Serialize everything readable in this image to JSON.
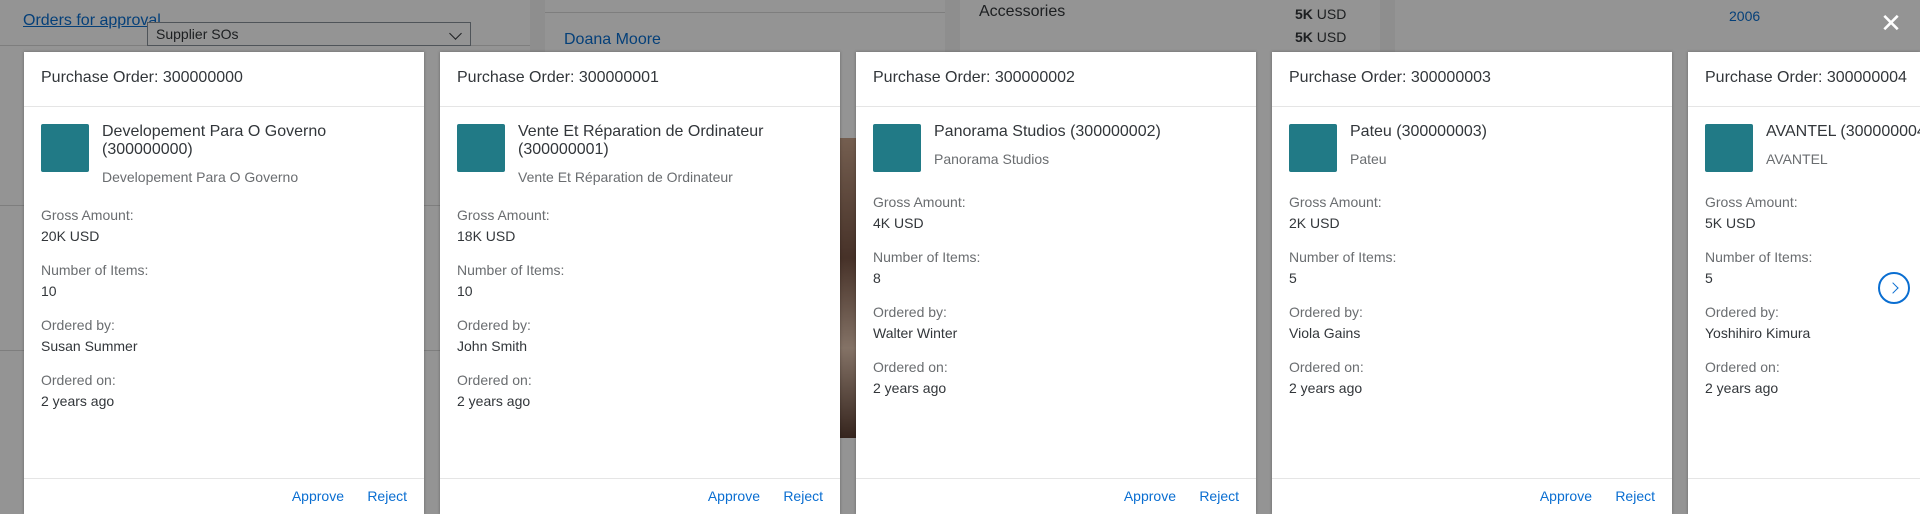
{
  "background": {
    "link": "Orders for approval",
    "select_value": "Supplier SOs",
    "person_name": "Doana Moore",
    "category": "Accessories",
    "amount_1": "5K",
    "amount_1_unit": "USD",
    "amount_2": "5K",
    "amount_2_unit": "USD",
    "year": "2006"
  },
  "close_icon": "close-icon",
  "cards": [
    {
      "header": "Purchase Order: 300000000",
      "title": "Developement Para O Governo (300000000)",
      "subtitle": "Developement Para O Governo",
      "gross_label": "Gross Amount:",
      "gross_value": "20K USD",
      "items_label": "Number of Items:",
      "items_value": "10",
      "ordered_by_label": "Ordered by:",
      "ordered_by_value": "Susan Summer",
      "ordered_on_label": "Ordered on:",
      "ordered_on_value": "2 years ago",
      "approve": "Approve",
      "reject": "Reject"
    },
    {
      "header": "Purchase Order: 300000001",
      "title": "Vente Et Réparation de Ordinateur (300000001)",
      "subtitle": "Vente Et Réparation de Ordinateur",
      "gross_label": "Gross Amount:",
      "gross_value": "18K USD",
      "items_label": "Number of Items:",
      "items_value": "10",
      "ordered_by_label": "Ordered by:",
      "ordered_by_value": "John Smith",
      "ordered_on_label": "Ordered on:",
      "ordered_on_value": "2 years ago",
      "approve": "Approve",
      "reject": "Reject"
    },
    {
      "header": "Purchase Order: 300000002",
      "title": "Panorama Studios (300000002)",
      "subtitle": "Panorama Studios",
      "gross_label": "Gross Amount:",
      "gross_value": "4K USD",
      "items_label": "Number of Items:",
      "items_value": "8",
      "ordered_by_label": "Ordered by:",
      "ordered_by_value": "Walter Winter",
      "ordered_on_label": "Ordered on:",
      "ordered_on_value": "2 years ago",
      "approve": "Approve",
      "reject": "Reject"
    },
    {
      "header": "Purchase Order: 300000003",
      "title": "Pateu (300000003)",
      "subtitle": "Pateu",
      "gross_label": "Gross Amount:",
      "gross_value": "2K USD",
      "items_label": "Number of Items:",
      "items_value": "5",
      "ordered_by_label": "Ordered by:",
      "ordered_by_value": "Viola Gains",
      "ordered_on_label": "Ordered on:",
      "ordered_on_value": "2 years ago",
      "approve": "Approve",
      "reject": "Reject"
    },
    {
      "header": "Purchase Order: 300000004",
      "title": "AVANTEL (300000004",
      "subtitle": "AVANTEL",
      "gross_label": "Gross Amount:",
      "gross_value": "5K USD",
      "items_label": "Number of Items:",
      "items_value": "5",
      "ordered_by_label": "Ordered by:",
      "ordered_by_value": "Yoshihiro Kimura",
      "ordered_on_label": "Ordered on:",
      "ordered_on_value": "2 years ago"
    }
  ],
  "avatar_color": "#217a86",
  "accent_color": "#0a6ed1",
  "next_icon": "chevron-right-icon"
}
